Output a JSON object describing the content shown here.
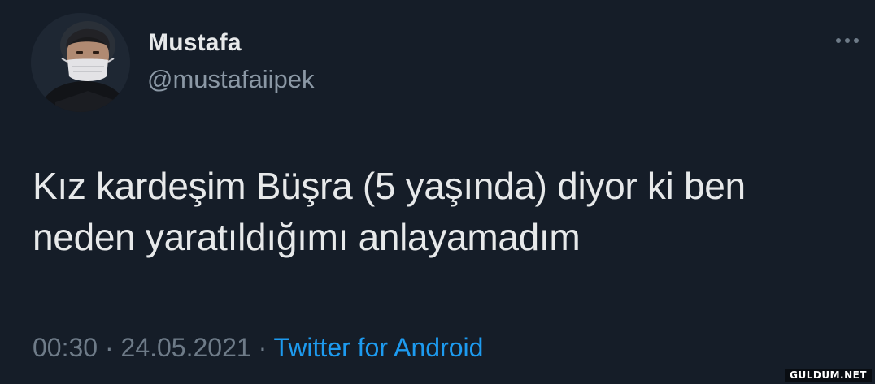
{
  "author": {
    "display_name": "Mustafa",
    "handle": "@mustafaiipek",
    "avatar_icon": "person-with-mask-avatar"
  },
  "tweet": {
    "text_line1": "Kız kardeşim Büşra (5 yaşında) diyor ki ben",
    "text_line2": "neden yaratıldığımı anlayamadım",
    "time": "00:30",
    "separator": "·",
    "date": "24.05.2021",
    "source": "Twitter for Android"
  },
  "actions": {
    "more_icon": "more-horizontal-icon"
  },
  "watermark": "GULDUM.NET",
  "colors": {
    "background": "#151d28",
    "primary_text": "#e7e9ea",
    "secondary_text": "#8b98a5",
    "link": "#1d9bf0"
  }
}
